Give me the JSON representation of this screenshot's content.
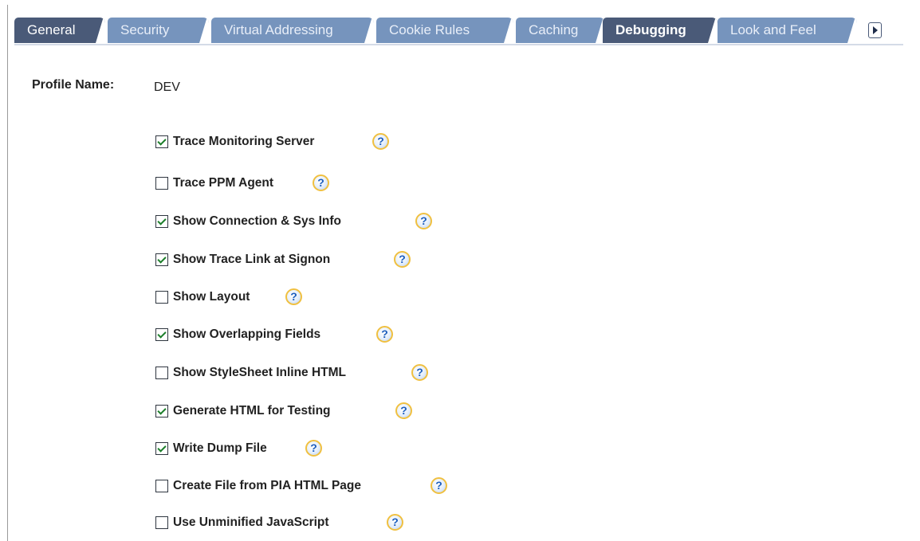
{
  "tabs": [
    {
      "label": "General",
      "state": "normal"
    },
    {
      "label": "Security",
      "state": "light"
    },
    {
      "label": "Virtual Addressing",
      "state": "light"
    },
    {
      "label": "Cookie Rules",
      "state": "light"
    },
    {
      "label": "Caching",
      "state": "light"
    },
    {
      "label": "Debugging",
      "state": "active"
    },
    {
      "label": "Look and Feel",
      "state": "light"
    }
  ],
  "tab_next_icon": "right-arrow-icon",
  "profile": {
    "label": "Profile Name:",
    "value": "DEV"
  },
  "help_glyph": "?",
  "options": [
    {
      "label": "Trace Monitoring Server",
      "checked": true
    },
    {
      "label": "Trace PPM Agent",
      "checked": false
    },
    {
      "label": "Show Connection & Sys Info",
      "checked": true
    },
    {
      "label": "Show Trace Link at Signon",
      "checked": true
    },
    {
      "label": "Show Layout",
      "checked": false
    },
    {
      "label": "Show Overlapping Fields",
      "checked": true
    },
    {
      "label": "Show StyleSheet Inline HTML",
      "checked": false
    },
    {
      "label": "Generate HTML for Testing",
      "checked": true
    },
    {
      "label": "Write Dump File",
      "checked": true
    },
    {
      "label": "Create File from PIA HTML Page",
      "checked": false
    },
    {
      "label": "Use Unminified JavaScript",
      "checked": false
    }
  ],
  "colors": {
    "tab_dark": "#4a5a78",
    "tab_light": "#7694bd",
    "check": "#1c7e2a",
    "help_border": "#f0c040"
  }
}
